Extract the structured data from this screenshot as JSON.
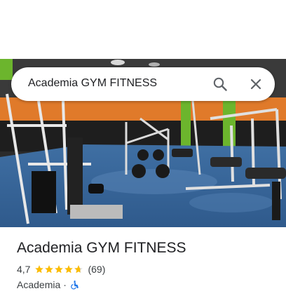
{
  "search": {
    "query": "Academia GYM FITNESS",
    "search_icon": "search-icon",
    "close_icon": "close-icon"
  },
  "photo": {
    "description_icon": "gym-photo"
  },
  "place": {
    "title": "Academia GYM FITNESS",
    "rating": "4,7",
    "rating_value": 4.7,
    "rating_max": 5,
    "review_count": "(69)",
    "category": "Academia",
    "separator": "·",
    "accessibility_icon": "wheelchair-accessible-icon"
  },
  "colors": {
    "star": "#fbbc04",
    "title": "#202124",
    "secondary": "#3c4043",
    "accessibility": "#1a73e8"
  }
}
